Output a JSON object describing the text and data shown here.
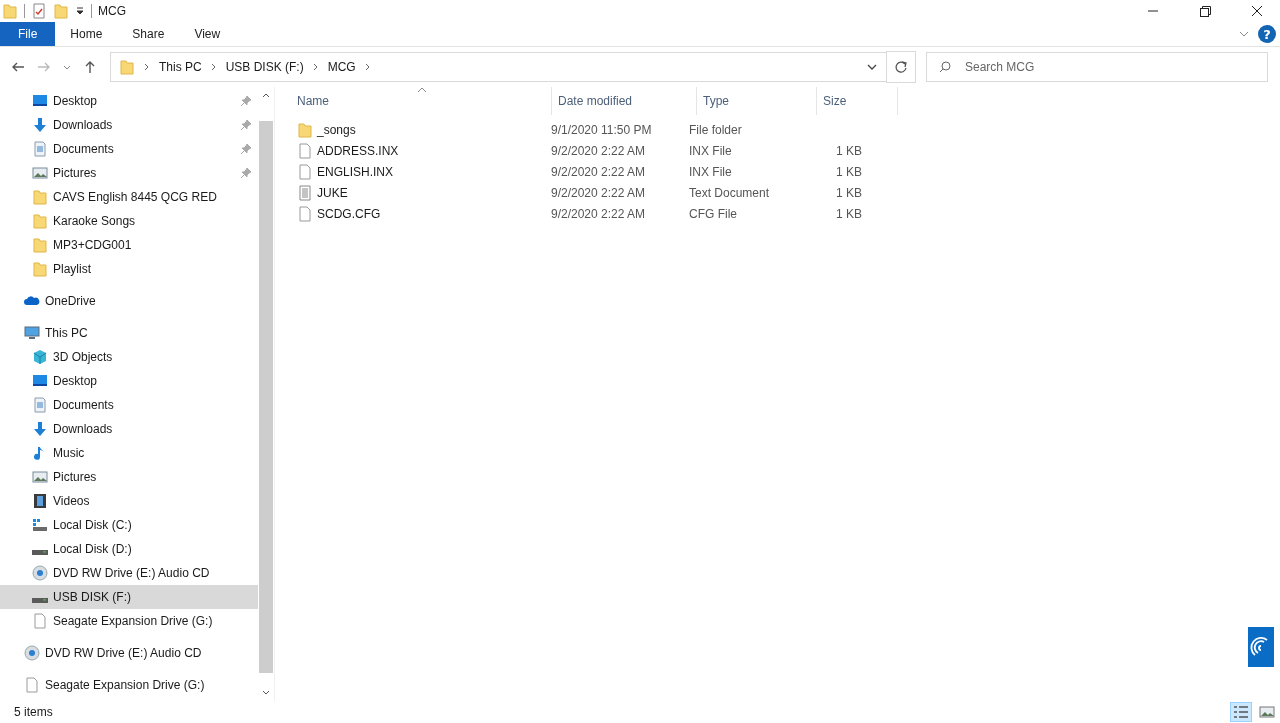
{
  "window": {
    "title": "MCG"
  },
  "ribbon_tabs": [
    {
      "label": "File",
      "selected": true
    },
    {
      "label": "Home",
      "selected": false
    },
    {
      "label": "Share",
      "selected": false
    },
    {
      "label": "View",
      "selected": false
    }
  ],
  "help_button": "?",
  "breadcrumb": [
    "This PC",
    "USB DISK (F:)",
    "MCG"
  ],
  "search": {
    "placeholder": "Search MCG"
  },
  "nav": {
    "quick_access": [
      {
        "label": "Desktop",
        "kind": "desktop",
        "pinned": true,
        "selected": false
      },
      {
        "label": "Downloads",
        "kind": "download",
        "pinned": true,
        "selected": false
      },
      {
        "label": "Documents",
        "kind": "document",
        "pinned": true,
        "selected": false
      },
      {
        "label": "Pictures",
        "kind": "pictures",
        "pinned": true,
        "selected": false
      },
      {
        "label": "CAVS English 8445 QCG RED",
        "kind": "folder",
        "pinned": false,
        "selected": false
      },
      {
        "label": "Karaoke Songs",
        "kind": "folder",
        "pinned": false,
        "selected": false
      },
      {
        "label": "MP3+CDG001",
        "kind": "folder",
        "pinned": false,
        "selected": false
      },
      {
        "label": "Playlist",
        "kind": "folder",
        "pinned": false,
        "selected": false
      }
    ],
    "roots": [
      {
        "label": "OneDrive",
        "kind": "cloud",
        "selected": false
      },
      {
        "label": "This PC",
        "kind": "pc",
        "selected": false,
        "children": [
          {
            "label": "3D Objects",
            "kind": "cube",
            "selected": false
          },
          {
            "label": "Desktop",
            "kind": "desktop",
            "selected": false
          },
          {
            "label": "Documents",
            "kind": "document",
            "selected": false
          },
          {
            "label": "Downloads",
            "kind": "download",
            "selected": false
          },
          {
            "label": "Music",
            "kind": "music",
            "selected": false
          },
          {
            "label": "Pictures",
            "kind": "pictures",
            "selected": false
          },
          {
            "label": "Videos",
            "kind": "video",
            "selected": false
          },
          {
            "label": "Local Disk (C:)",
            "kind": "sysdrive",
            "selected": false
          },
          {
            "label": "Local Disk (D:)",
            "kind": "drive",
            "selected": false
          },
          {
            "label": "DVD RW Drive (E:) Audio CD",
            "kind": "disc",
            "selected": false
          },
          {
            "label": "USB DISK (F:)",
            "kind": "drive",
            "selected": true
          },
          {
            "label": "Seagate Expansion Drive (G:)",
            "kind": "blank",
            "selected": false
          }
        ]
      },
      {
        "label": "DVD RW Drive (E:) Audio CD",
        "kind": "disc",
        "selected": false
      },
      {
        "label": "Seagate Expansion Drive (G:)",
        "kind": "blank",
        "selected": false
      }
    ]
  },
  "table": {
    "columns": [
      "Name",
      "Date modified",
      "Type",
      "Size"
    ],
    "rows": [
      {
        "kind": "folder",
        "name": "_songs",
        "date": "9/1/2020 11:50 PM",
        "type": "File folder"
      },
      {
        "kind": "blank",
        "name": "ADDRESS.INX",
        "date": "9/2/2020 2:22 AM",
        "type": "INX File",
        "size": "1 KB"
      },
      {
        "kind": "blank",
        "name": "ENGLISH.INX",
        "date": "9/2/2020 2:22 AM",
        "type": "INX File",
        "size": "1 KB"
      },
      {
        "kind": "text",
        "name": "JUKE",
        "date": "9/2/2020 2:22 AM",
        "type": "Text Document",
        "size": "1 KB"
      },
      {
        "kind": "blank",
        "name": "SCDG.CFG",
        "date": "9/2/2020 2:22 AM",
        "type": "CFG File",
        "size": "1 KB"
      }
    ]
  },
  "status_bar": {
    "count": "5 items"
  },
  "view_buttons": [
    {
      "kind": "details",
      "selected": true
    },
    {
      "kind": "large",
      "selected": false
    }
  ]
}
